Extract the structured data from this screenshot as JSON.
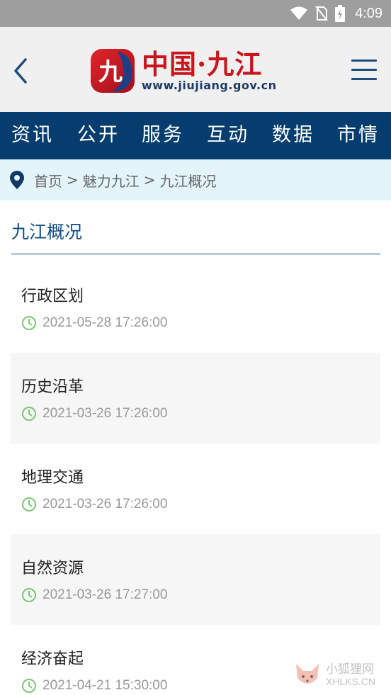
{
  "status_bar": {
    "time": "4:09",
    "icons": [
      "wifi-icon",
      "no-sim-icon",
      "battery-charging-icon"
    ]
  },
  "header": {
    "logo_title": "中国·九江",
    "logo_url": "www.jiujiang.gov.cn",
    "logo_emblem_text": "九",
    "back_icon": "chevron-left-icon",
    "menu_icon": "hamburger-menu-icon"
  },
  "nav": {
    "items": [
      {
        "label": "资讯"
      },
      {
        "label": "公开"
      },
      {
        "label": "服务"
      },
      {
        "label": "互动"
      },
      {
        "label": "数据"
      },
      {
        "label": "市情"
      }
    ]
  },
  "breadcrumb": {
    "icon": "location-pin-icon",
    "items": [
      "首页",
      "魅力九江",
      "九江概况"
    ],
    "separator": ">"
  },
  "section": {
    "title": "九江概况"
  },
  "articles": [
    {
      "title": "行政区划",
      "date": "2021-05-28 17:26:00"
    },
    {
      "title": "历史沿革",
      "date": "2021-03-26 17:26:00"
    },
    {
      "title": "地理交通",
      "date": "2021-03-26 17:26:00"
    },
    {
      "title": "自然资源",
      "date": "2021-03-26 17:27:00"
    },
    {
      "title": "经济奋起",
      "date": "2021-04-21 15:30:00"
    }
  ],
  "watermark": {
    "cn": "小狐狸网",
    "en": "XHLKS.CN"
  },
  "colors": {
    "status_bar": "#9e9e9e",
    "header_bg": "#f0f0f0",
    "nav_bg": "#053d6e",
    "breadcrumb_bg": "#e3f5fb",
    "accent": "#0f4c86",
    "logo_red": "#c8161d",
    "clock_green": "#7cc576",
    "shaded_row": "#f6f6f6"
  }
}
